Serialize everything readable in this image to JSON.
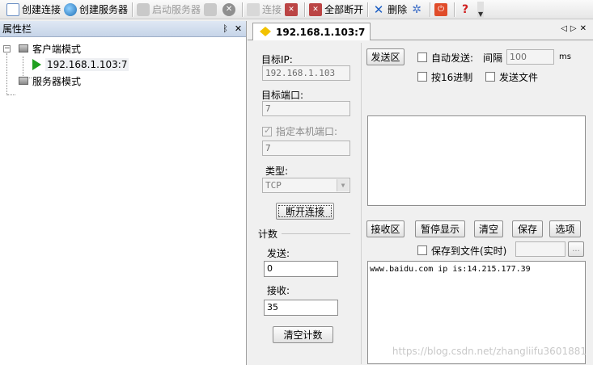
{
  "toolbar": {
    "create_connection": "创建连接",
    "create_server": "创建服务器",
    "start_server": "启动服务器",
    "connect": "连接",
    "disconnect_all": "全部断开",
    "delete": "删除"
  },
  "property_panel": {
    "title": "属性栏",
    "pin_glyph": "ᛒ",
    "close_glyph": "✕",
    "tree": {
      "client_mode": "客户端模式",
      "connection": "192.168.1.103:7",
      "server_mode": "服务器模式"
    }
  },
  "tab": {
    "label": "192.168.1.103:7",
    "nav": "◁▷✕"
  },
  "form": {
    "target_ip_label": "目标IP:",
    "target_ip": "192.168.1.103",
    "target_port_label": "目标端口:",
    "target_port": "7",
    "local_port_label": "指定本机端口:",
    "local_port": "7",
    "type_label": "类型:",
    "type_value": "TCP",
    "disconnect_button": "断开连接",
    "count_label": "计数",
    "send_label": "发送:",
    "send_count": "0",
    "recv_label": "接收:",
    "recv_count": "35",
    "clear_count_button": "清空计数"
  },
  "send_area": {
    "button": "发送区",
    "auto_send": "自动发送:",
    "interval_label": "间隔",
    "interval_value": "100",
    "interval_unit": "ms",
    "hex": "按16进制",
    "send_file": "发送文件"
  },
  "recv_area": {
    "button": "接收区",
    "pause": "暂停显示",
    "clear": "清空",
    "save": "保存",
    "options": "选项",
    "save_to_file": "保存到文件(实时)",
    "browse": "...",
    "content": "www.baidu.com ip is:14.215.177.39",
    "watermark": "https://blog.csdn.net/zhangliifu3601881"
  }
}
